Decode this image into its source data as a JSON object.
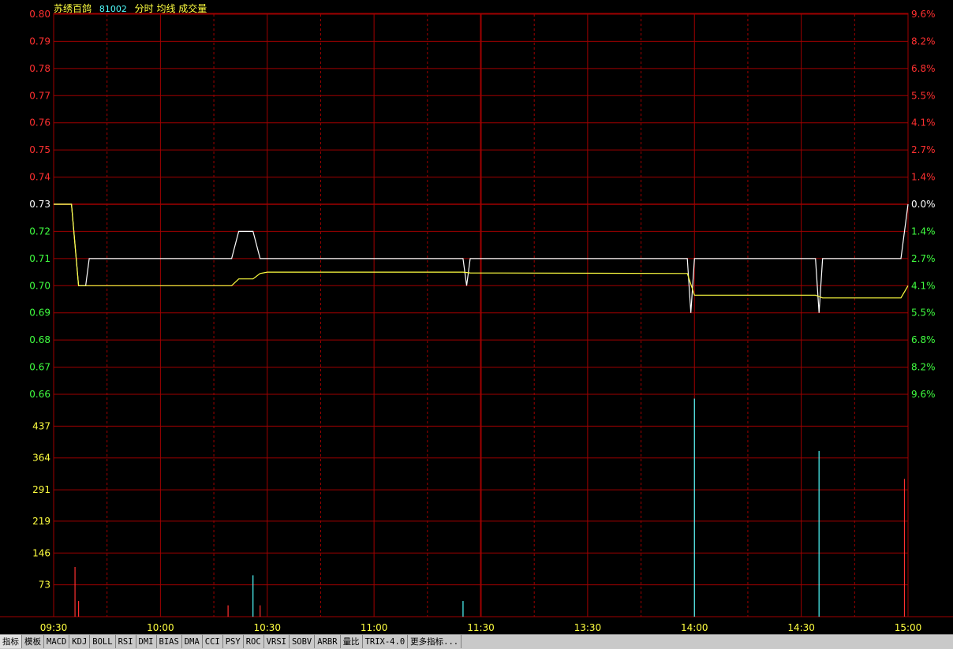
{
  "header": {
    "name": "苏绣百鸽",
    "code": "81002",
    "labels": "分时 均线 成交量"
  },
  "colors": {
    "up": "#ff3030",
    "down": "#40ff40",
    "flat": "#ffffff",
    "price_line": "#ffffff",
    "avg_line": "#ffff40",
    "vol_up": "#ff3030",
    "vol_down": "#50ffff",
    "grid": "#a00000",
    "axis_text": "#ffff40"
  },
  "tabs": [
    "指标",
    "模板",
    "MACD",
    "KDJ",
    "BOLL",
    "RSI",
    "DMI",
    "BIAS",
    "DMA",
    "CCI",
    "PSY",
    "ROC",
    "VRSI",
    "SOBV",
    "ARBR",
    "量比",
    "TRIX-4.0",
    "更多指标..."
  ],
  "chart_data": {
    "type": "line",
    "time_axis": [
      "09:30",
      "10:00",
      "10:30",
      "11:00",
      "11:30",
      "13:30",
      "14:00",
      "14:30",
      "15:00"
    ],
    "price_axis": {
      "labels": [
        "0.80",
        "0.79",
        "0.78",
        "0.77",
        "0.76",
        "0.75",
        "0.74",
        "0.73",
        "0.72",
        "0.71",
        "0.70",
        "0.69",
        "0.68",
        "0.67",
        "0.66"
      ],
      "pct_labels": [
        "9.6%",
        "8.2%",
        "6.8%",
        "5.5%",
        "4.1%",
        "2.7%",
        "1.4%",
        "0.0%",
        "1.4%",
        "2.7%",
        "4.1%",
        "5.5%",
        "6.8%",
        "8.2%",
        "9.6%"
      ],
      "ylim": [
        0.66,
        0.8
      ],
      "prev_close": 0.73
    },
    "volume_axis": {
      "labels": [
        "437",
        "364",
        "291",
        "219",
        "146",
        "73"
      ],
      "ylim": [
        0,
        510
      ]
    },
    "series": [
      {
        "name": "分时",
        "points": [
          [
            0,
            0.73
          ],
          [
            5,
            0.73
          ],
          [
            7,
            0.7
          ],
          [
            9,
            0.7
          ],
          [
            10,
            0.71
          ],
          [
            50,
            0.71
          ],
          [
            52,
            0.72
          ],
          [
            56,
            0.72
          ],
          [
            58,
            0.71
          ],
          [
            115,
            0.71
          ],
          [
            116,
            0.7
          ],
          [
            117,
            0.71
          ],
          [
            178,
            0.71
          ],
          [
            179,
            0.69
          ],
          [
            180,
            0.71
          ],
          [
            214,
            0.71
          ],
          [
            215,
            0.69
          ],
          [
            216,
            0.71
          ],
          [
            238,
            0.71
          ],
          [
            240,
            0.73
          ]
        ]
      },
      {
        "name": "均线",
        "points": [
          [
            0,
            0.73
          ],
          [
            5,
            0.73
          ],
          [
            7,
            0.7
          ],
          [
            50,
            0.7
          ],
          [
            52,
            0.7025
          ],
          [
            56,
            0.7025
          ],
          [
            58,
            0.7045
          ],
          [
            60,
            0.705
          ],
          [
            115,
            0.705
          ],
          [
            117,
            0.7047
          ],
          [
            178,
            0.7045
          ],
          [
            180,
            0.6965
          ],
          [
            214,
            0.6965
          ],
          [
            216,
            0.6955
          ],
          [
            238,
            0.6955
          ],
          [
            240,
            0.7
          ]
        ]
      }
    ],
    "volume": [
      {
        "t": 6,
        "v": 114,
        "dir": "up"
      },
      {
        "t": 7,
        "v": 36,
        "dir": "up"
      },
      {
        "t": 49,
        "v": 26,
        "dir": "up"
      },
      {
        "t": 56,
        "v": 95,
        "dir": "down"
      },
      {
        "t": 58,
        "v": 26,
        "dir": "up"
      },
      {
        "t": 115,
        "v": 36,
        "dir": "down"
      },
      {
        "t": 180,
        "v": 500,
        "dir": "down"
      },
      {
        "t": 215,
        "v": 380,
        "dir": "down"
      },
      {
        "t": 239,
        "v": 316,
        "dir": "up"
      }
    ]
  }
}
